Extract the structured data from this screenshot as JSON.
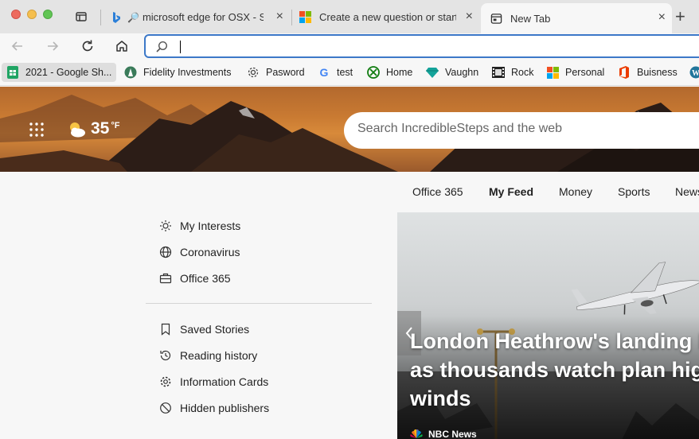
{
  "tabs": [
    {
      "label": "microsoft edge for OSX - S"
    },
    {
      "label": "Create a new question or start"
    },
    {
      "label": "New Tab"
    }
  ],
  "address_bar": {
    "value": ""
  },
  "bookmarks": [
    {
      "label": "2021 - Google Sh...",
      "icon": "google-sheets-icon"
    },
    {
      "label": "Fidelity Investments",
      "icon": "fidelity-icon"
    },
    {
      "label": "Pasword",
      "icon": "gear-icon"
    },
    {
      "label": "test",
      "icon": "google-icon"
    },
    {
      "label": "Home",
      "icon": "xbox-icon"
    },
    {
      "label": "Vaughn",
      "icon": "gem-icon"
    },
    {
      "label": "Rock",
      "icon": "film-icon"
    },
    {
      "label": "Personal",
      "icon": "microsoft-icon"
    },
    {
      "label": "Buisness",
      "icon": "office-icon"
    }
  ],
  "weather": {
    "temp": "35",
    "unit": "°F"
  },
  "hero_search": {
    "placeholder": "Search IncredibleSteps and the web"
  },
  "feed_nav": [
    "Office 365",
    "My Feed",
    "Money",
    "Sports",
    "News"
  ],
  "menu": {
    "group1": [
      "My Interests",
      "Coronavirus",
      "Office 365"
    ],
    "group2": [
      "Saved Stories",
      "Reading history",
      "Information Cards",
      "Hidden publishers"
    ]
  },
  "card": {
    "headline": "London Heathrow's landing hit as thousands watch plan high winds",
    "source": "NBC News"
  },
  "colors": {
    "accent": "#3c78c8",
    "hero_orange": "#c97a32"
  }
}
